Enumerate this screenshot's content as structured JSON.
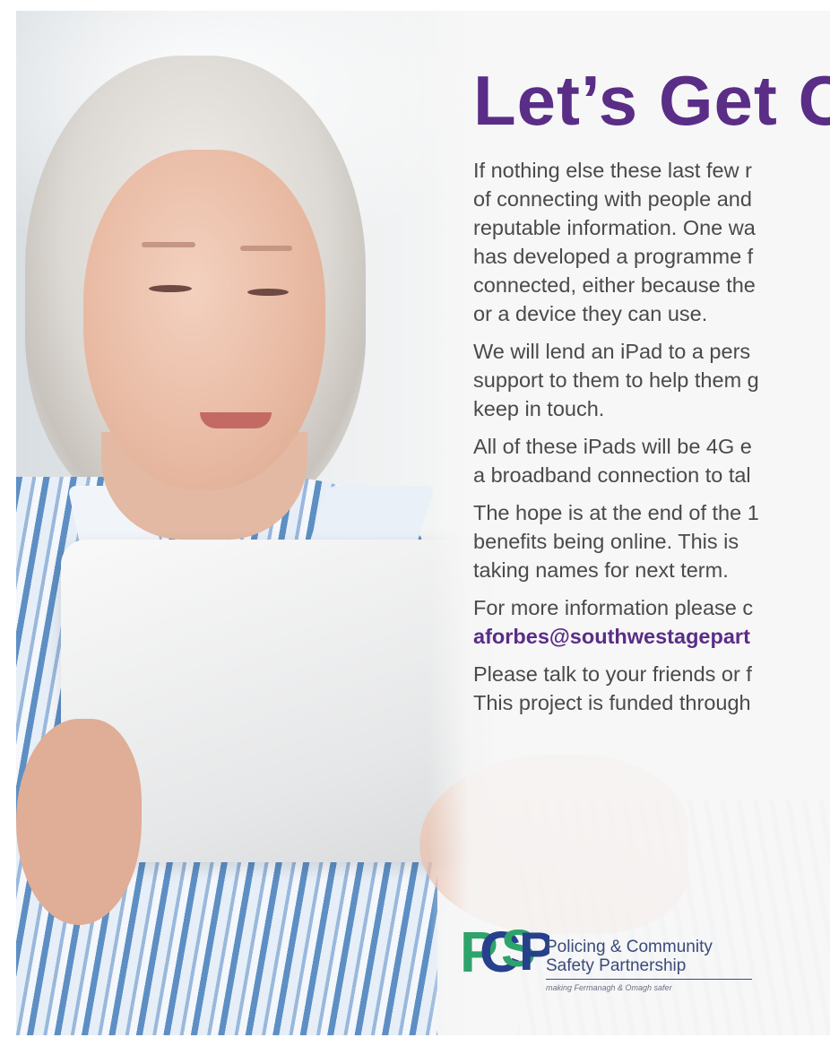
{
  "title": "Let’s Get C",
  "paragraphs": [
    [
      "If nothing else these last few r",
      "of connecting with people and",
      "reputable information. One wa",
      "has developed a programme f",
      "connected, either because the",
      "or a device they can use."
    ],
    [
      "We will lend an iPad to a pers",
      "support to them to help them g",
      "keep in touch."
    ],
    [
      "All of these iPads will be 4G e",
      "a broadband connection to tal"
    ],
    [
      "The hope is at the end of the 1",
      "benefits being online.  This is",
      "taking names for next term."
    ]
  ],
  "contact": {
    "line1": "For more information please c",
    "email": "aforbes@southwestagepart"
  },
  "closing": [
    "Please talk to your friends or f",
    "This project is funded through"
  ],
  "logo": {
    "mark": "PCSP",
    "line1": "Policing & Community",
    "line2": "Safety Partnership",
    "tagline": "making Fermanagh & Omagh safer"
  },
  "colors": {
    "title": "#5a2d86",
    "body_text": "#4a4a4a",
    "email": "#5a2d86",
    "logo_green": "#2ea36b",
    "logo_blue": "#27408b"
  }
}
